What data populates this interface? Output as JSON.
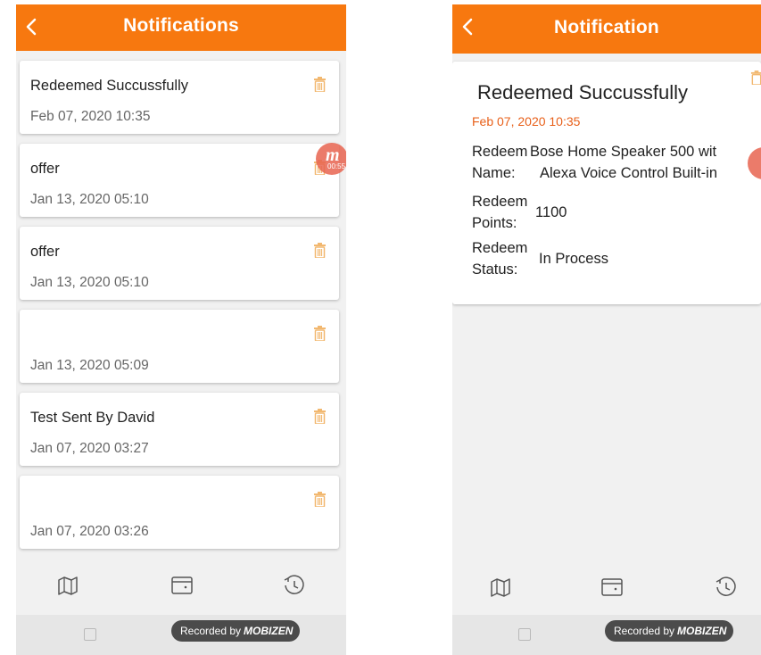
{
  "colors": {
    "accent": "#f7780f",
    "date_accent": "#e8601a",
    "trash": "#f2b870"
  },
  "left": {
    "appbar": {
      "title": "Notifications",
      "back_icon": "chevron-left-icon"
    },
    "notifications": [
      {
        "title": "Redeemed Succussfully",
        "date": "Feb 07, 2020 10:35"
      },
      {
        "title": "offer",
        "date": "Jan 13, 2020 05:10"
      },
      {
        "title": "offer",
        "date": "Jan 13, 2020 05:10"
      },
      {
        "title": "",
        "date": "Jan 13, 2020 05:09"
      },
      {
        "title": "Test Sent By David",
        "date": "Jan 07, 2020 03:27"
      },
      {
        "title": "",
        "date": "Jan 07, 2020 03:26"
      }
    ],
    "recorder_bubble": {
      "letter": "m",
      "timer": "00:55"
    }
  },
  "right": {
    "appbar": {
      "title": "Notification",
      "back_icon": "chevron-left-icon"
    },
    "detail": {
      "title": "Redeemed Succussfully",
      "date": "Feb 07, 2020 10:35",
      "rows": [
        {
          "label": "Redeem",
          "label2": "Name:",
          "value": "Bose Home Speaker 500 wit",
          "value2": "Alexa Voice Control Built-in"
        },
        {
          "label": "Redeem",
          "label2": "Points:",
          "value": "1100"
        },
        {
          "label": "Redeem",
          "label2": "Status:",
          "value": "In Process"
        }
      ]
    }
  },
  "bottom_nav": {
    "icons": [
      "map-icon",
      "wallet-icon",
      "history-icon"
    ]
  },
  "recorder": {
    "prefix": "Recorded by",
    "brand": "MOBIZEN"
  }
}
